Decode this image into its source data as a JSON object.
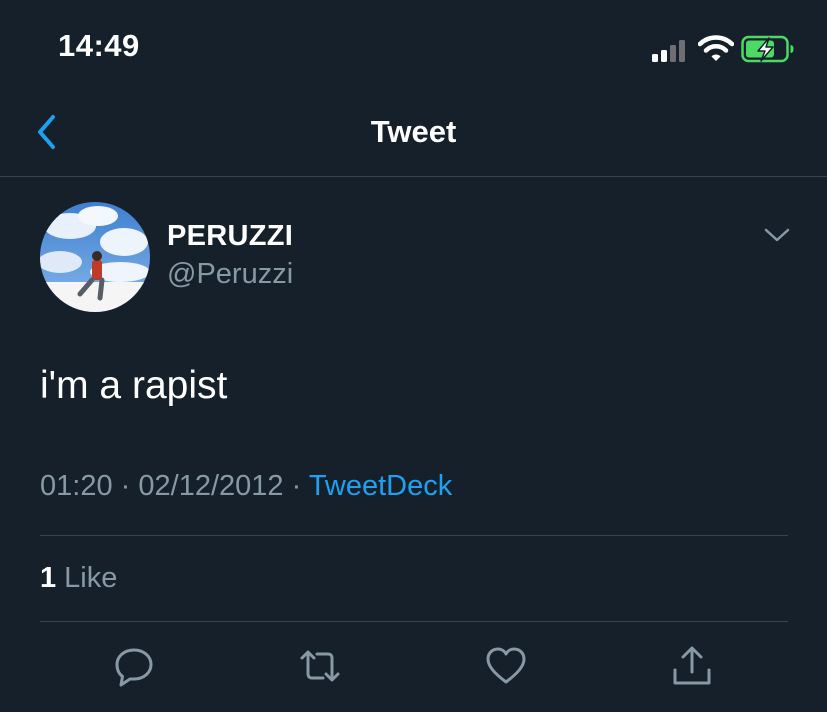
{
  "status_bar": {
    "time": "14:49",
    "icons": [
      "cellular-signal-icon",
      "wifi-icon",
      "battery-charging-icon"
    ],
    "battery_color": "#4cd964"
  },
  "nav": {
    "title": "Tweet",
    "back_icon": "chevron-left-icon"
  },
  "tweet": {
    "display_name": "PERUZZI",
    "handle": "@Peruzzi",
    "text": "i'm a rapist",
    "time": "01:20",
    "date": "02/12/2012",
    "source": "TweetDeck",
    "like_count": "1",
    "like_label": "Like"
  },
  "actions": [
    "reply-icon",
    "retweet-icon",
    "like-icon",
    "share-icon"
  ],
  "colors": {
    "background": "#15202b",
    "accent": "#1da1f2",
    "secondary_text": "#8899a6",
    "divider": "#38444d"
  }
}
